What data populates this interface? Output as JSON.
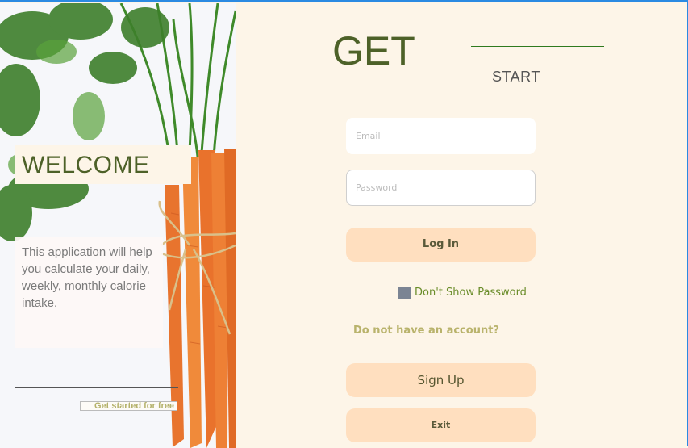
{
  "left": {
    "welcome": "WELCOME",
    "description": "This application will help you calculate your daily, weekly, monthly calorie intake.",
    "get_started": "Get started for free"
  },
  "header": {
    "title": "GET",
    "subtitle": "START"
  },
  "form": {
    "email_placeholder": "Email",
    "password_placeholder": "Password",
    "login_label": "Log In",
    "show_password_label": "Don't Show Password",
    "no_account_label": "Do not have an account?",
    "signup_label": "Sign Up",
    "exit_label": "Exit"
  },
  "colors": {
    "accent_green": "#4d6128",
    "button_peach": "#ffdfbf",
    "background": "#fdf5e8",
    "title_bar_border": "#2b8ae2"
  },
  "icons": [
    "carrot-image",
    "checkbox-icon"
  ]
}
